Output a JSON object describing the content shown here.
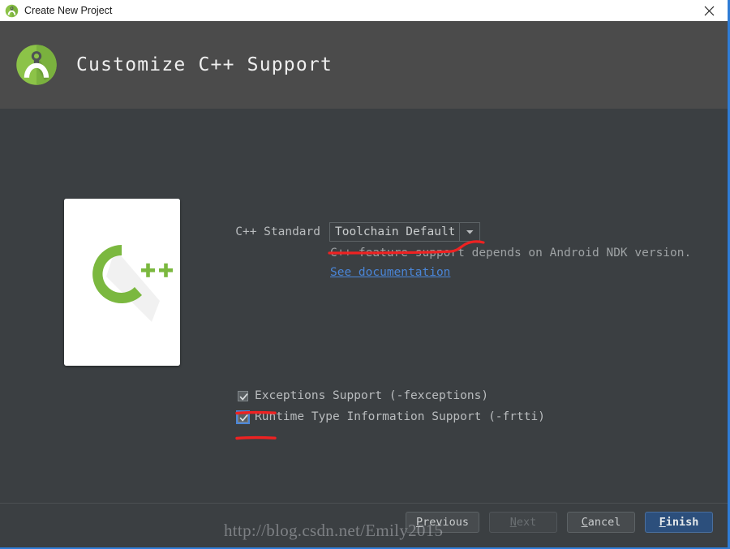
{
  "titlebar": {
    "title": "Create New Project",
    "icon": "android-studio-icon",
    "close_label": "close-icon"
  },
  "header": {
    "title": "Customize C++ Support",
    "icon": "android-studio-icon"
  },
  "illustration": {
    "name": "cpp-logo-card",
    "text": "C++"
  },
  "form": {
    "standard_label": "C++ Standard",
    "standard_value": "Toolchain Default",
    "hint": "C++ feature support depends on Android NDK version.",
    "doc_link": "See documentation"
  },
  "checkboxes": [
    {
      "label": "Exceptions Support (-fexceptions)",
      "checked": true,
      "focused": false,
      "name": "exceptions-support-checkbox"
    },
    {
      "label": "Runtime Type Information Support (-frtti)",
      "checked": true,
      "focused": true,
      "name": "rtti-support-checkbox"
    }
  ],
  "footer": {
    "buttons": [
      {
        "label": "Previous",
        "mnemonic": "P",
        "state": "enabled",
        "name": "previous-button"
      },
      {
        "label": "Next",
        "mnemonic": "N",
        "state": "disabled",
        "name": "next-button"
      },
      {
        "label": "Cancel",
        "mnemonic": "C",
        "state": "enabled",
        "name": "cancel-button"
      },
      {
        "label": "Finish",
        "mnemonic": "F",
        "state": "default",
        "name": "finish-button"
      }
    ]
  },
  "watermark": "http://blog.csdn.net/Emily2015",
  "colors": {
    "header_bg": "#4b4b4b",
    "body_bg": "#3b3f42",
    "titlebar_bg": "#ffffff",
    "accent_border": "#2e7cd6",
    "link": "#4a86d8",
    "default_button": "#2c4f7c",
    "annotation": "#ee2222",
    "cpp_green": "#7bb83f"
  }
}
